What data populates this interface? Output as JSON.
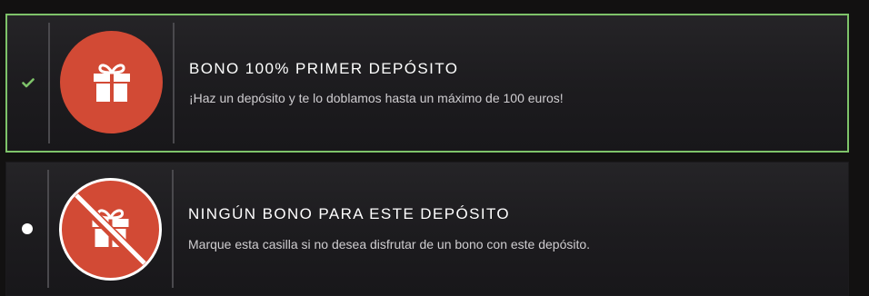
{
  "options": [
    {
      "title": "BONO 100% PRIMER DEPÓSITO",
      "description": "¡Haz un depósito y te lo doblamos hasta un máximo de 100 euros!",
      "icon": "gift-icon",
      "state": "selected",
      "indicator": "check-icon"
    },
    {
      "title": "NINGÚN BONO PARA ESTE DEPÓSITO",
      "description": "Marque esta casilla si no desea disfrutar de un bono con este depósito.",
      "icon": "no-gift-icon",
      "state": "unselected",
      "indicator": "radio-dot"
    }
  ],
  "colors": {
    "selected_border": "#7ec36a",
    "check": "#7ec36a",
    "icon_background": "#d24a35",
    "panel_background": "#1f1e21",
    "page_background": "#121111",
    "title_text": "#ffffff",
    "description_text": "#cfcdd0"
  }
}
